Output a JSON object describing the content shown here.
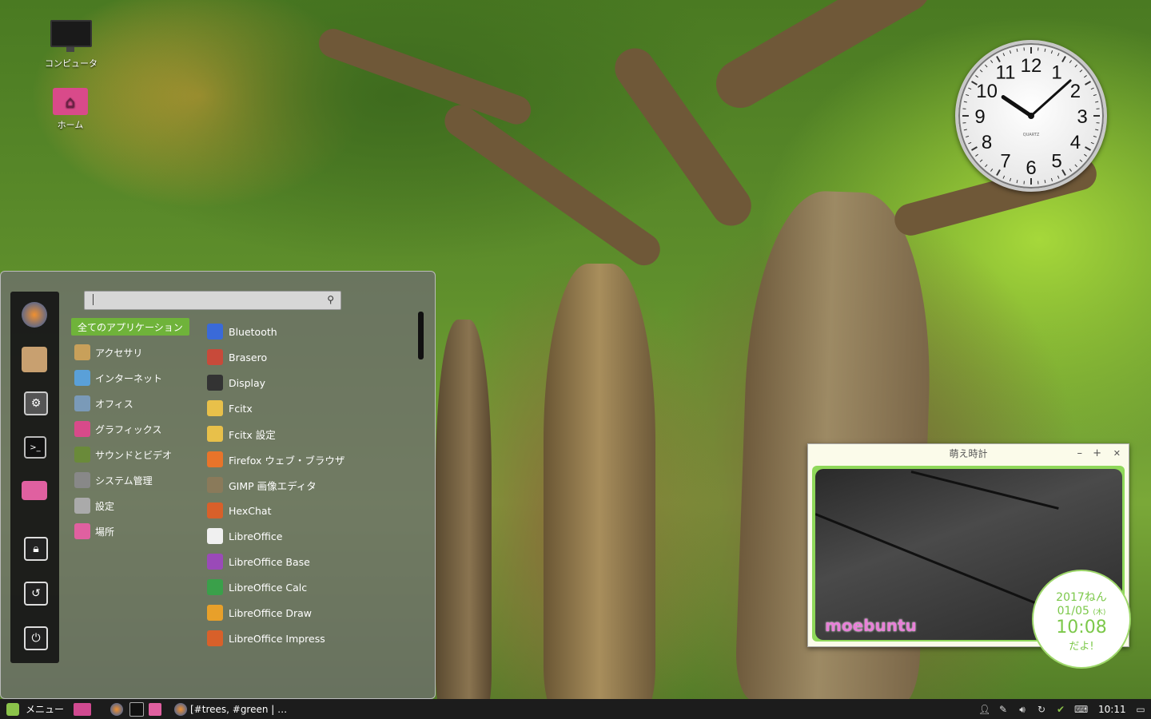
{
  "desktop": {
    "icons": [
      {
        "label": "コンピュータ",
        "icon": "computer-icon"
      },
      {
        "label": "ホーム",
        "icon": "home-folder-icon"
      }
    ]
  },
  "clock": {
    "numerals": [
      "12",
      "1",
      "2",
      "3",
      "4",
      "5",
      "6",
      "7",
      "8",
      "9",
      "10",
      "11"
    ],
    "brand": "QUARTZ",
    "time": "10:08"
  },
  "menu": {
    "search": {
      "placeholder": "",
      "value": ""
    },
    "favorites": [
      "firefox-icon",
      "software-manager-icon",
      "system-settings-icon",
      "terminal-icon",
      "files-icon",
      "lock-screen-icon",
      "logout-icon",
      "shutdown-icon"
    ],
    "categories": [
      {
        "label": "全てのアプリケーション",
        "selected": true,
        "color": "#6fb33a"
      },
      {
        "label": "アクセサリ",
        "color": "#c8a05a"
      },
      {
        "label": "インターネット",
        "color": "#5aa0d8"
      },
      {
        "label": "オフィス",
        "color": "#7a9ab8"
      },
      {
        "label": "グラフィックス",
        "color": "#d84a8a"
      },
      {
        "label": "サウンドとビデオ",
        "color": "#6a8a3a"
      },
      {
        "label": "システム管理",
        "color": "#888888"
      },
      {
        "label": "設定",
        "color": "#aaaaaa"
      },
      {
        "label": "場所",
        "color": "#e060a0"
      }
    ],
    "apps": [
      {
        "label": "Bluetooth",
        "color": "#3a6ad8"
      },
      {
        "label": "Brasero",
        "color": "#c84a3a"
      },
      {
        "label": "Display",
        "color": "#333333"
      },
      {
        "label": "Fcitx",
        "color": "#e8c04a"
      },
      {
        "label": "Fcitx 設定",
        "color": "#e8c04a"
      },
      {
        "label": "Firefox ウェブ・ブラウザ",
        "color": "#e8742a"
      },
      {
        "label": "GIMP 画像エディタ",
        "color": "#8a7a5a"
      },
      {
        "label": "HexChat",
        "color": "#d8602a"
      },
      {
        "label": "LibreOffice",
        "color": "#f0f0f0"
      },
      {
        "label": "LibreOffice Base",
        "color": "#9a4ab8"
      },
      {
        "label": "LibreOffice Calc",
        "color": "#3aa04a"
      },
      {
        "label": "LibreOffice Draw",
        "color": "#e8a02a"
      },
      {
        "label": "LibreOffice Impress",
        "color": "#d8602a"
      }
    ]
  },
  "moe_widget": {
    "title": "萌え時計",
    "controls": {
      "minimize": "–",
      "maximize": "+",
      "close": "✕"
    },
    "logo": "moebuntu",
    "bubble": {
      "year": "2017ねん",
      "date": "01/05",
      "weekday": "(木)",
      "time": "10:08",
      "suffix": "だよ!"
    }
  },
  "panel": {
    "menu_label": "メニュー",
    "window_title": "[#trees, #green | …",
    "tray": [
      "user-icon",
      "network-icon",
      "volume-icon",
      "update-icon",
      "shield-icon",
      "keyboard-icon"
    ],
    "time": "10:11",
    "show_desktop": "show-desktop-icon"
  }
}
